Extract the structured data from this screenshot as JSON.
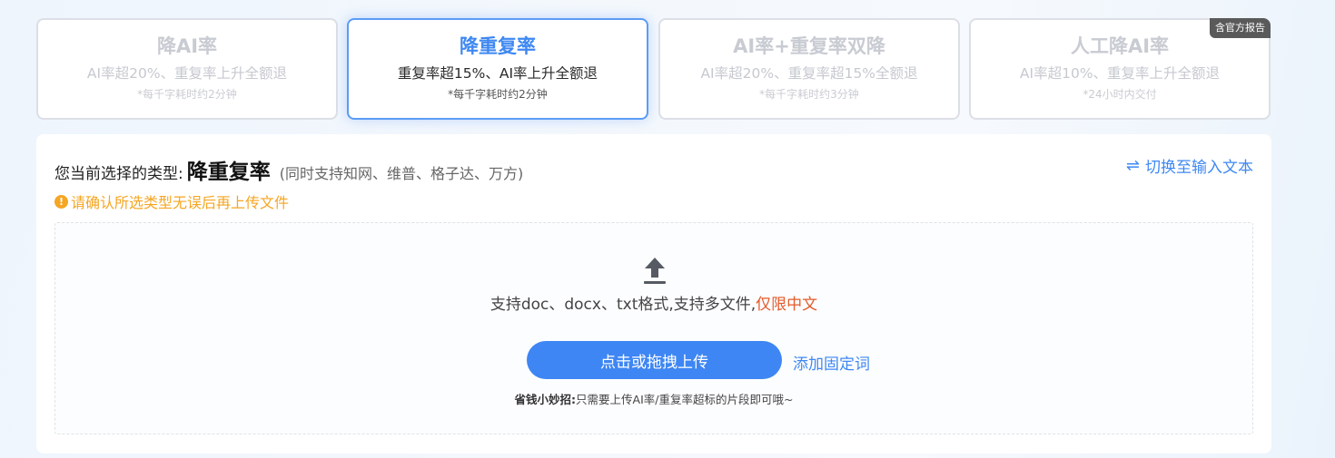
{
  "cards": [
    {
      "title": "降AI率",
      "desc": "AI率超20%、重复率上升全额退",
      "note": "*每千字耗时约2分钟",
      "active": false
    },
    {
      "title": "降重复率",
      "desc": "重复率超15%、AI率上升全额退",
      "note": "*每千字耗时约2分钟",
      "active": true
    },
    {
      "title": "AI率+重复率双降",
      "desc": "AI率超20%、重复率超15%全额退",
      "note": "*每千字耗时约3分钟",
      "active": false
    },
    {
      "title": "人工降AI率",
      "desc": "AI率超10%、重复率上升全额退",
      "note": "*24小时内交付",
      "active": false,
      "badge": "含官方报告"
    }
  ],
  "selection": {
    "label": "您当前选择的类型:",
    "type": "降重复率",
    "support": "(同时支持知网、维普、格子达、万方)",
    "warning_icon": "!",
    "warning": "请确认所选类型无误后再上传文件"
  },
  "switch": {
    "icon": "⇌",
    "label": "切换至输入文本"
  },
  "upload": {
    "formats": "支持doc、docx、txt格式,支持多文件,",
    "formats_highlight": "仅限中文",
    "button": "点击或拖拽上传",
    "fixed_words": "添加固定词",
    "tip_bold": "省钱小妙招:",
    "tip": "只需要上传AI率/重复率超标的片段即可哦~"
  }
}
